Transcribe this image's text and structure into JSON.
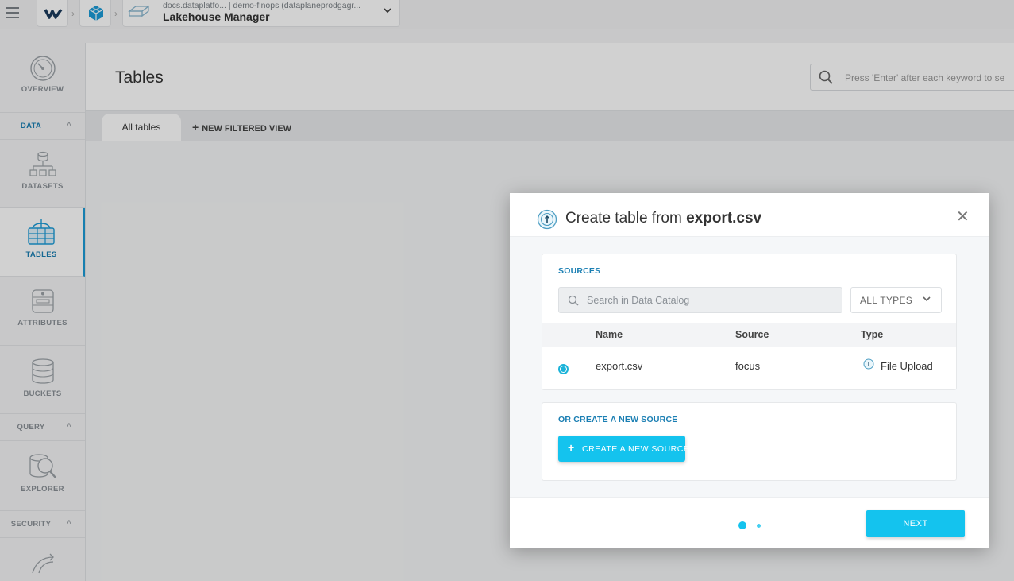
{
  "header": {
    "org_label": "docs.dataplatfo...",
    "project_path": "| demo-finops (dataplaneprodgagr...",
    "project_name": "Lakehouse Manager"
  },
  "sidebar": {
    "items": [
      {
        "label": "OVERVIEW",
        "icon": "gauge-icon"
      },
      {
        "label": "DATASETS",
        "icon": "datasets-icon"
      },
      {
        "label": "TABLES",
        "icon": "tables-icon",
        "active": true
      },
      {
        "label": "ATTRIBUTES",
        "icon": "attributes-icon"
      },
      {
        "label": "BUCKETS",
        "icon": "buckets-icon"
      },
      {
        "label": "EXPLORER",
        "icon": "explorer-icon"
      }
    ],
    "sections": {
      "data": "DATA",
      "query": "QUERY",
      "security": "SECURITY"
    }
  },
  "main": {
    "title": "Tables",
    "search_placeholder": "Press 'Enter' after each keyword to se",
    "tabs": [
      {
        "label": "All tables",
        "active": true
      },
      {
        "label": "NEW FILTERED VIEW"
      }
    ]
  },
  "modal": {
    "title_prefix": "Create table from",
    "title_file": "export.csv",
    "sources_header": "SOURCES",
    "search_placeholder": "Search in Data Catalog",
    "types_filter": "ALL TYPES",
    "columns": [
      "Name",
      "Source",
      "Type"
    ],
    "rows": [
      {
        "name": "export.csv",
        "source": "focus",
        "type": "File Upload",
        "selected": true
      }
    ],
    "create_header": "OR CREATE A NEW SOURCE",
    "create_button": "CREATE A NEW SOURCE",
    "next_button": "NEXT",
    "step": 1,
    "steps_total": 2
  },
  "colors": {
    "accent": "#14c3ee",
    "link": "#1b7fb3",
    "sidebar_active": "#1b9bd7"
  }
}
